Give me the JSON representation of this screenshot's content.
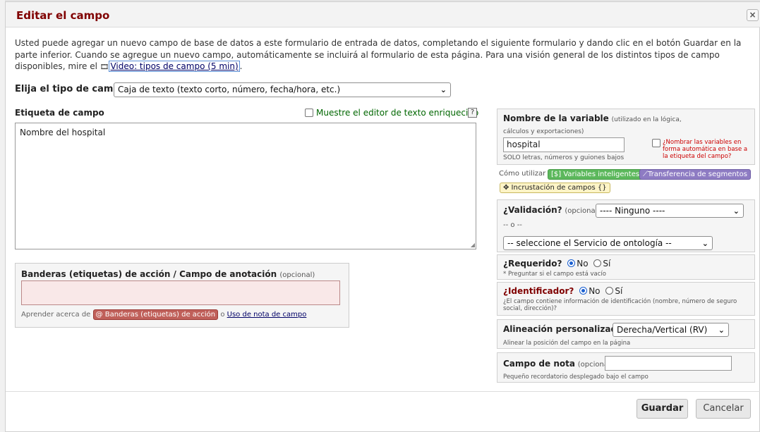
{
  "dialog": {
    "title": "Editar el campo",
    "close_label": "×"
  },
  "intro": {
    "text_before": "Usted puede agregar un nuevo campo de base de datos a este formulario de entrada de datos, completando el siguiente formulario y dando clic en el botón Guardar en la parte inferior. Cuando se agregue un nuevo campo, automáticamente se incluirá al formulario de esta página. Para una visión general de los distintos tipos de campo disponibles, mire el ",
    "video_link": "Video: tipos de campo (5 min)",
    "text_after": "."
  },
  "field_type": {
    "label": "Elija el tipo de campo",
    "selected": "Caja de texto (texto corto, número, fecha/hora, etc.)"
  },
  "field_label": {
    "title": "Etiqueta de campo",
    "rich_text_toggle": "Muestre el editor de texto enriquecido",
    "help": "?",
    "value": "Nombre del hospital"
  },
  "action_tags": {
    "title": "Banderas (etiquetas) de acción / Campo de anotación",
    "optional": "(opcional)",
    "learn_prefix": "Aprender acerca de",
    "tags_button": "@ Banderas (etiquetas) de acción",
    "or": "o",
    "note_link": "Uso de nota de campo"
  },
  "variable": {
    "title": "Nombre de la variable",
    "hint": "(utilizado en la lógica, cálculos y exportaciones)",
    "value": "hospital",
    "restriction": "SOLO letras, números y guiones bajos",
    "auto_name": "¿Nombrar las variables en forma automática en base a la etiqueta del campo?"
  },
  "howto": {
    "label": "Cómo utilizar",
    "smart_vars": "[$] Variables inteligentes",
    "piping": "Transferencia de segmentos",
    "embedding": "✥ Incrustación de campos {}"
  },
  "validation": {
    "label": "¿Validación?",
    "optional": "(opcional)",
    "selected": "---- Ninguno ----",
    "or": "-- o --",
    "ontology": "-- seleccione el Servicio de ontología --"
  },
  "required": {
    "label": "¿Requerido?",
    "no": "No",
    "yes": "Sí",
    "note": "* Preguntar si el campo está vacío",
    "selected": "No"
  },
  "identifier": {
    "label": "¿Identificador?",
    "no": "No",
    "yes": "Sí",
    "note": "¿El campo contiene información de identificación (nombre, número de seguro social, dirección)?",
    "selected": "No"
  },
  "alignment": {
    "label": "Alineación personalizada",
    "selected": "Derecha/Vertical (RV)",
    "note": "Alinear la posición del campo en la página"
  },
  "field_note": {
    "label": "Campo de nota",
    "optional": "(opcional)",
    "note": "Pequeño recordatorio desplegado bajo el campo"
  },
  "footer": {
    "save": "Guardar",
    "cancel": "Cancelar"
  },
  "colors": {
    "title": "#800000",
    "smart_vars": "#5cb85c",
    "piping": "#8e7cc3",
    "embedding": "#fdf4c7"
  }
}
